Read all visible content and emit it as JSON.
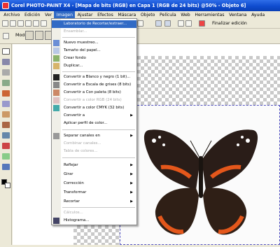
{
  "window": {
    "title": "Corel PHOTO-PAINT X4 - [Mapa de bits (RGB) en Capa 1 (RGB de 24 bits) @50% - Objeto 6]"
  },
  "menubar": [
    "Archivo",
    "Edición",
    "Ver",
    "Imagen",
    "Ajustar",
    "Efectos",
    "Máscara",
    "Objeto",
    "Película",
    "Web",
    "Herramientas",
    "Ventana",
    "Ayuda"
  ],
  "active_menu": "Imagen",
  "toolbar": {
    "finalizar": "Finalizar edición"
  },
  "propbar": {
    "modo_label": "Modo"
  },
  "menu": {
    "items": [
      {
        "label": "Laboratorio de Recortar/extraer...",
        "hl": true
      },
      {
        "label": "Ensamblar...",
        "disabled": true
      },
      {
        "label": "Nuevo muestreo..."
      },
      {
        "label": "Tamaño del papel..."
      },
      {
        "label": "Crear fondo"
      },
      {
        "label": "Duplicar..."
      },
      {
        "label": "Convertir a Blanco y negro (1 bit)..."
      },
      {
        "label": "Convertir a Escala de grises (8 bits)"
      },
      {
        "label": "Convertir a Con paleta (8 bits)"
      },
      {
        "label": "Convertir a color RGB (24 bits)",
        "disabled": true
      },
      {
        "label": "Convertir a color CMYK (32 bits)"
      },
      {
        "label": "Convertir a",
        "arrow": true
      },
      {
        "label": "Aplicar perfil de color..."
      },
      {
        "label": "Separar canales en",
        "arrow": true
      },
      {
        "label": "Combinar canales...",
        "disabled": true
      },
      {
        "label": "Tabla de colores...",
        "disabled": true
      },
      {
        "label": "Reflejar",
        "arrow": true
      },
      {
        "label": "Girar",
        "arrow": true
      },
      {
        "label": "Corrección",
        "arrow": true
      },
      {
        "label": "Transformar",
        "arrow": true
      },
      {
        "label": "Recortar",
        "arrow": true
      },
      {
        "label": "Cálculos...",
        "disabled": true
      },
      {
        "label": "Histograma..."
      }
    ]
  },
  "colors": {
    "menu_highlight": "#316ac5",
    "title_blue": "#0f4ccf"
  }
}
